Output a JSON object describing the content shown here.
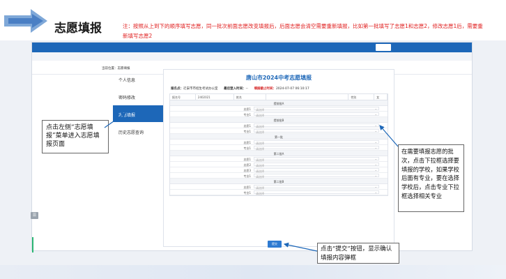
{
  "slide": {
    "title": "志愿填报",
    "note": "注：按照从上到下的顺序填写志愿，同一批次前面志愿改变填报后，后面志愿会清空需要重新填报，比如第一批填写了志愿1和志愿2，修改志愿1后，需要重新填写志愿2"
  },
  "app": {
    "breadcrumb": "当前位置：志愿填报",
    "sidebar": [
      {
        "label": "个人信息",
        "active": false
      },
      {
        "label": "密码修改",
        "active": false
      },
      {
        "label": "志愿填报",
        "active": true
      },
      {
        "label": "历史志愿查询",
        "active": false
      }
    ],
    "form": {
      "title": "唐山市2024中考志愿填报",
      "org_label": "报名点：",
      "org_value": "迁安市市招生考试办公室",
      "last_login_label": "最后登入时间：",
      "last_login_value": "--",
      "deadline_label": "填报截止时间：",
      "deadline_value": "2024-07-07 06:10:17",
      "header": [
        "报名号",
        "2402021",
        "姓名",
        "",
        "性别",
        "女"
      ],
      "select_placeholder": "请选择",
      "groups": [
        {
          "name": "提前批A",
          "rows": [
            "志愿1",
            "专业1"
          ]
        },
        {
          "name": "提前批B",
          "rows": [
            "志愿1",
            "专业1"
          ]
        },
        {
          "name": "第一批",
          "rows": [
            "志愿1",
            "专业1"
          ]
        },
        {
          "name": "第二批A",
          "rows": [
            "志愿1",
            "志愿2",
            "志愿3",
            "专业1"
          ]
        },
        {
          "name": "第二批B",
          "rows": [
            "志愿1",
            "专业1"
          ]
        }
      ],
      "submit_label": "提交"
    }
  },
  "callouts": {
    "menu": "点击左侧“志愿填报”菜单进入志愿填报页面",
    "dropdown": "在需要填报志愿的批次，点击下拉框选择要填报的学校，如果学校后面有专业，要在选择学校后，点击专业下拉框选择相关专业",
    "submit": "点击“提交”按钮，显示确认填报内容弹框"
  }
}
